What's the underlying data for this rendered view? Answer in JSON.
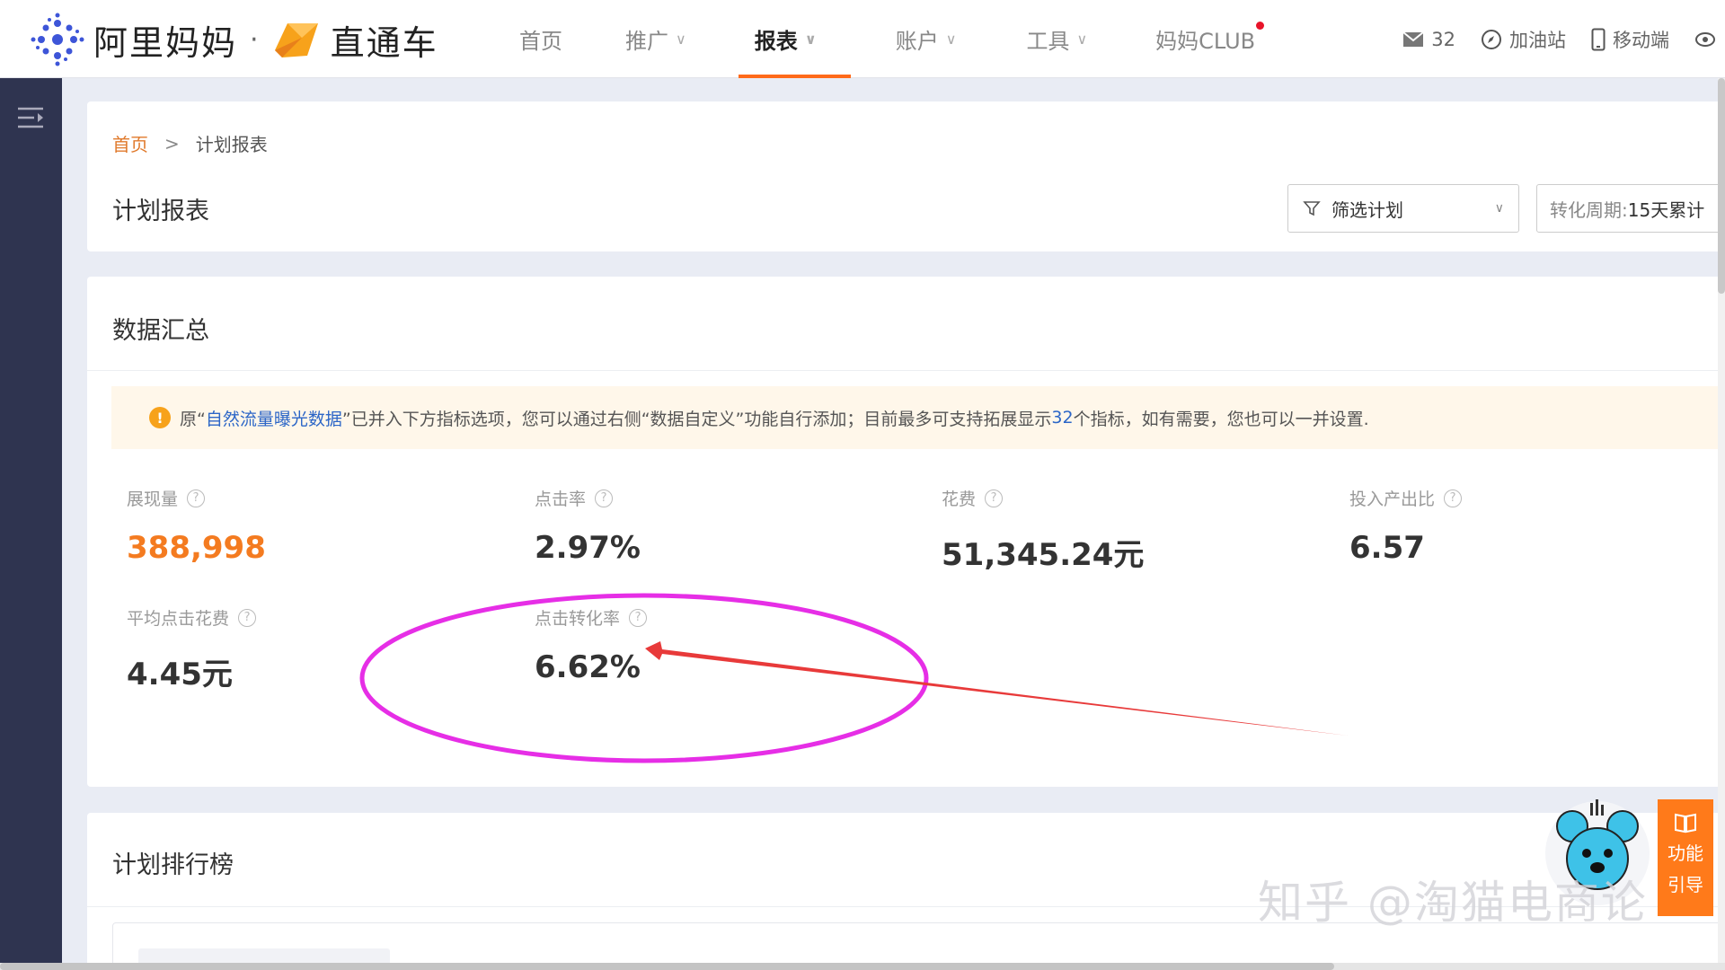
{
  "header": {
    "brand": "阿里妈妈",
    "separator": "·",
    "product": "直通车",
    "nav": [
      {
        "label": "首页",
        "has_menu": false
      },
      {
        "label": "推广",
        "has_menu": true
      },
      {
        "label": "报表",
        "has_menu": true,
        "active": true
      },
      {
        "label": "账户",
        "has_menu": true
      },
      {
        "label": "工具",
        "has_menu": true
      },
      {
        "label": "妈妈CLUB",
        "has_menu": false,
        "has_dot": true
      }
    ],
    "messages_count": "32",
    "gas_station": "加油站",
    "mobile": "移动端"
  },
  "breadcrumb": {
    "home": "首页",
    "separator": ">",
    "current": "计划报表"
  },
  "page_title": "计划报表",
  "filter": {
    "label": "筛选计划"
  },
  "period": {
    "label": "转化周期:",
    "value": "15天累计"
  },
  "summary": {
    "title": "数据汇总",
    "notice": {
      "prefix": "原“",
      "link": "自然流量曝光数据",
      "middle": "”已并入下方指标选项，您可以通过右侧“数据自定义”功能自行添加；目前最多可支持拓展显示",
      "count": "32",
      "suffix": "个指标，如有需要，您也可以一并设置."
    },
    "metrics": [
      {
        "label": "展现量",
        "value": "388,998",
        "highlight": true
      },
      {
        "label": "点击率",
        "value": "2.97%"
      },
      {
        "label": "花费",
        "value": "51,345.24元"
      },
      {
        "label": "投入产出比",
        "value": "6.57"
      },
      {
        "label": "平均点击花费",
        "value": "4.45元"
      },
      {
        "label": "点击转化率",
        "value": "6.62%"
      }
    ]
  },
  "ranking": {
    "title": "计划排行榜"
  },
  "guide": {
    "line1": "功能",
    "line2": "引导"
  },
  "watermark": "知乎 @淘猫电商论",
  "colors": {
    "accent": "#ff6a1a",
    "annotation_circle": "#e62ee6",
    "annotation_arrow": "#e83a3a",
    "sidebar": "#2f3450"
  }
}
